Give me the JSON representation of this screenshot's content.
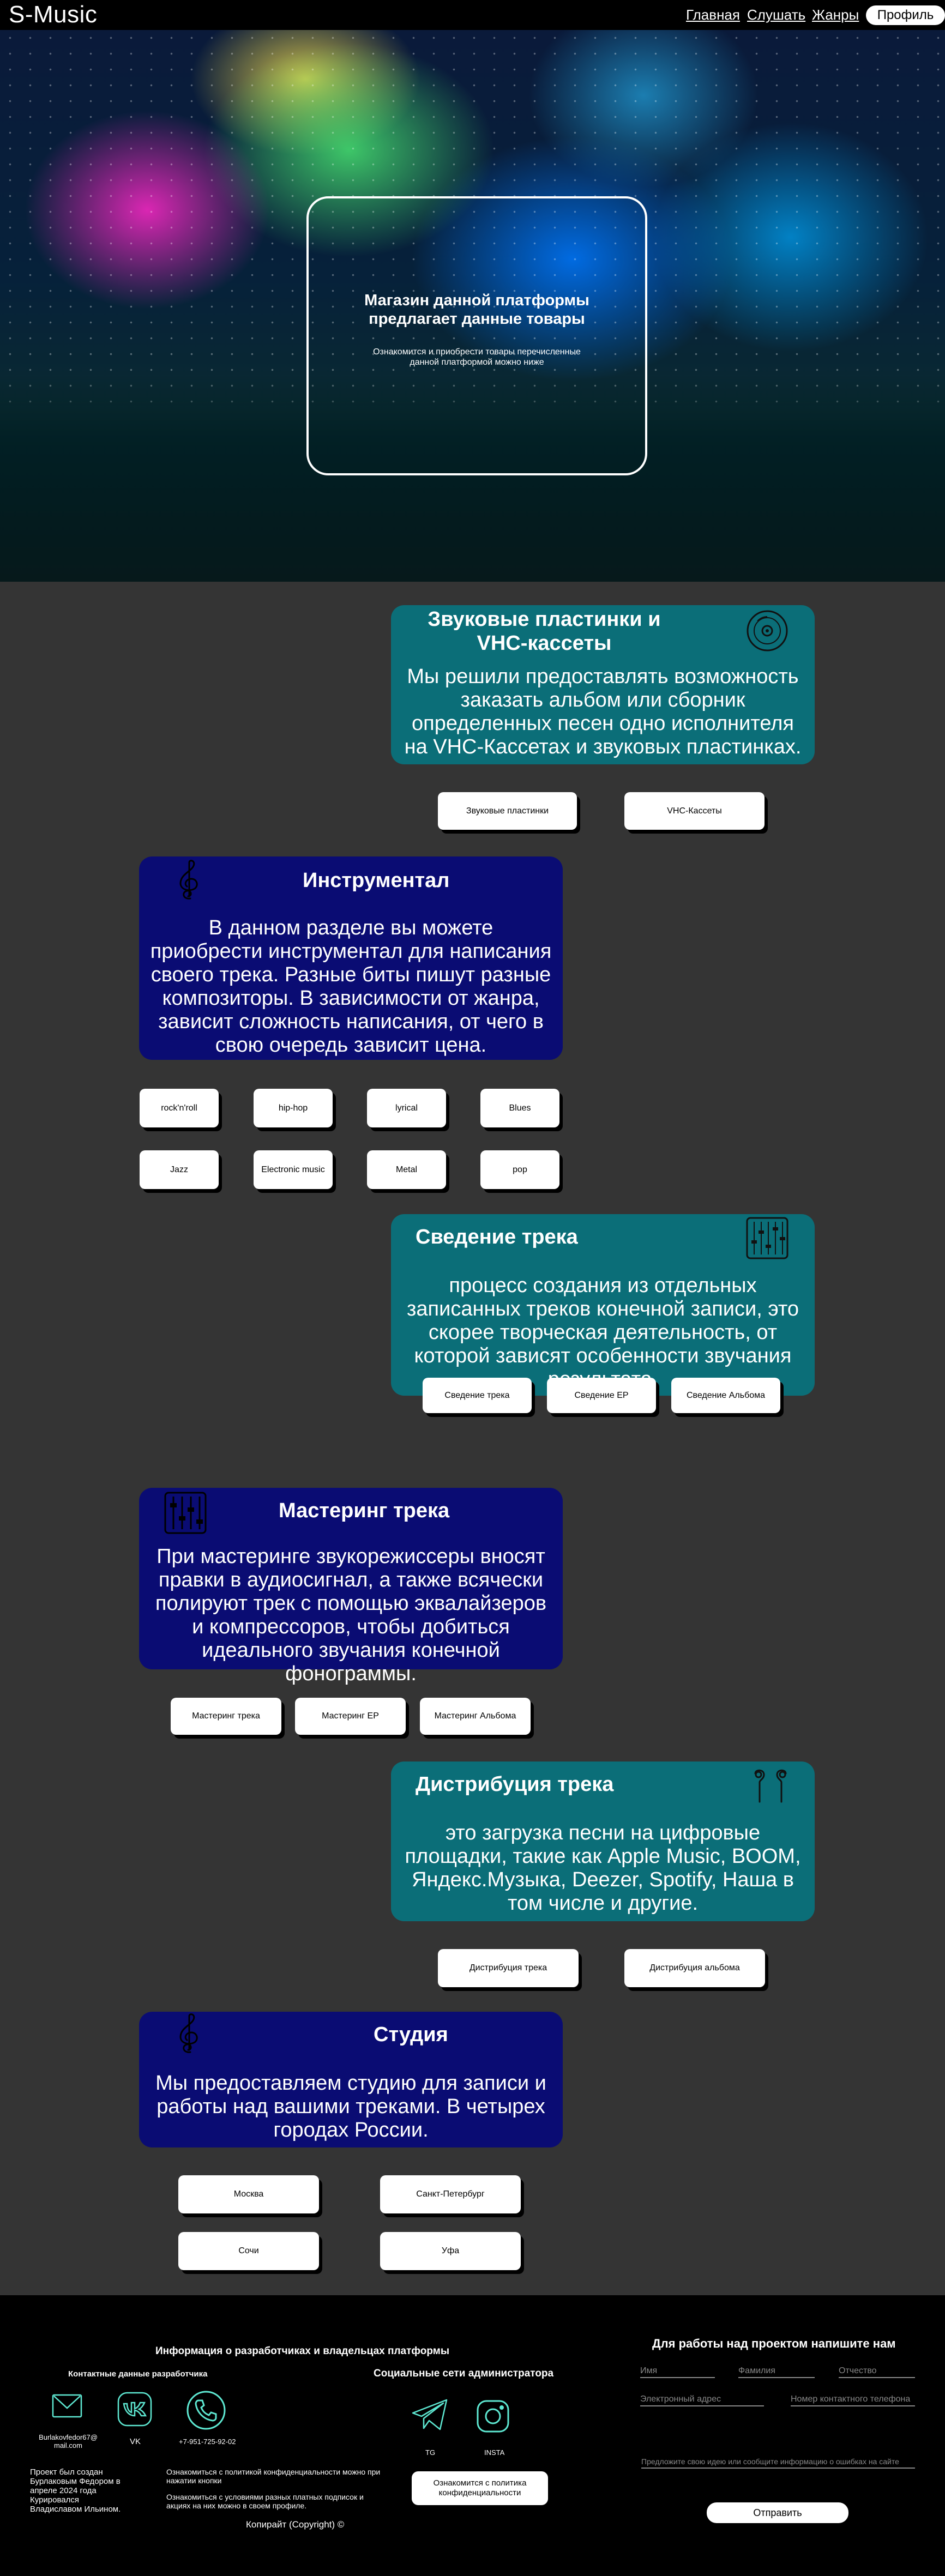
{
  "header": {
    "logo": "S-Music",
    "nav": [
      "Главная",
      "Слушать",
      "Жанры"
    ],
    "profile": "Профиль"
  },
  "hero": {
    "title": "Магазин данной платформы предлагает данные товары",
    "subtitle": "Ознакомится и приобрести товары перечисленные данной платформой можно ниже"
  },
  "sections": {
    "vinyl": {
      "title": "Звуковые пластинки и VHC-кассеты",
      "text": "Мы решили предоставлять возможность заказать альбом или сборник определенных песен одно исполнителя на VHC-Кассетах и звуковых пластинках.",
      "icon": "vinyl-record-icon",
      "buttons": [
        "Звуковые пластинки",
        "VHC-Кассеты"
      ]
    },
    "instrumental": {
      "title": "Инструментал",
      "text": "В данном разделе вы можете приобрести инструментал для написания своего трека. Разные биты пишут разные композиторы. В зависимости от жанра, зависит сложность написания, от чего в свою очередь зависит цена.",
      "icon": "treble-clef-icon",
      "buttons": [
        "rock'n'roll",
        "hip-hop",
        "lyrical",
        "Blues",
        "Jazz",
        "Electronic music",
        "Metal",
        "pop"
      ]
    },
    "mixing": {
      "title": "Сведение трека",
      "text": "процесс создания из отдельных записанных треков конечной записи, это скорее творческая деятельность, от которой зависят особенности звучания результата.",
      "icon": "mixer-console-icon",
      "buttons": [
        "Сведение трека",
        "Сведение ЕР",
        "Сведение Альбома"
      ]
    },
    "mastering": {
      "title": "Мастеринг трека",
      "text": "При мастеринге звукорежиссеры вносят правки в аудиосигнал, а также всячески полируют трек с помощью эквалайзеров и компрессоров, чтобы добиться идеального звучания конечной фонограммы.",
      "icon": "equalizer-icon",
      "buttons": [
        "Мастеринг трека",
        "Мастеринг ЕР",
        "Мастеринг Альбома"
      ]
    },
    "distribution": {
      "title": "Дистрибуция трека",
      "text": "это загрузка песни на цифровые площадки, такие как Apple Music, BOOM, Яндекс.Музыка, Deezer, Spotify, Наша в том числе и другие.",
      "icon": "earbuds-icon",
      "buttons": [
        "Дистрибуция трека",
        "Дистрибуция альбома"
      ]
    },
    "studio": {
      "title": "Студия",
      "text": "Мы предоставляем студию для записи и работы над вашими треками. В четырех городах России.",
      "icon": "treble-clef-icon",
      "buttons": [
        "Москва",
        "Санкт-Петербург",
        "Сочи",
        "Уфа"
      ]
    }
  },
  "footer": {
    "info_title": "Информация о разработчиках и владельцах платформы",
    "dev_contacts_title": "Контактные данные разработчика",
    "email": "Burlakovfedor67@mail.com",
    "vk": "VK",
    "phone": "+7-951-725-92-02",
    "socials_title": "Социальные сети администратора",
    "tg": "TG",
    "insta": "INSTA",
    "project_note": "Проект был создан Бурлаковым Федором в апреле 2024 года Курировался Владиславом Ильином.",
    "policy_note_1": "Ознакомиться с политикой конфиденциальности можно при нажатии кнопки",
    "policy_note_2": "Ознакомиться с условиями разных платных подписок и акциях на них можно в своем профиле.",
    "policy_button": "Ознакомится с политика конфиденциальности",
    "copyright": "Копирайт (Copyright) ©",
    "form_title": "Для работы над проектом напишите нам",
    "form_first_name": "Имя",
    "form_last_name": "Фамилия",
    "form_patronymic": "Отчество",
    "form_email": "Электронный адрес",
    "form_phone": "Номер контактного телефона",
    "form_message": "Предложите свою идею или сообщите информацию о ошибках на сайте",
    "form_submit": "Отправить"
  }
}
